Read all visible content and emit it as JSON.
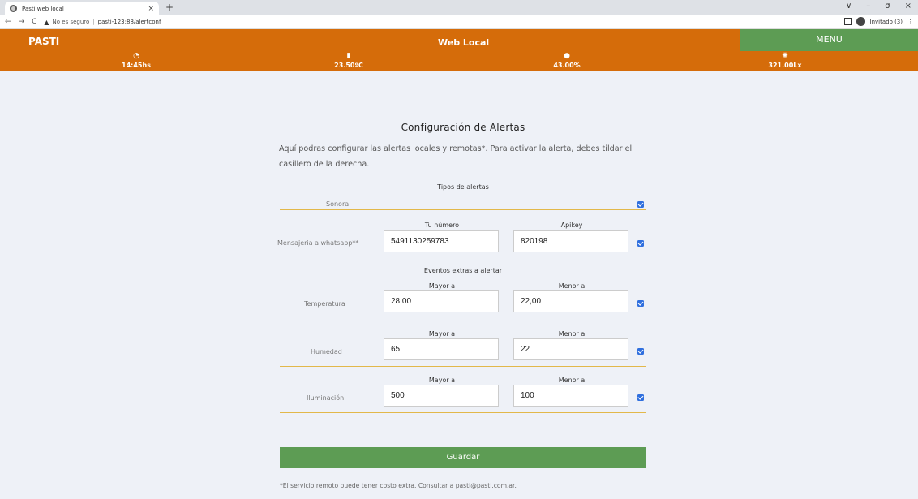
{
  "browser": {
    "tab_title": "Pasti web local",
    "tab_close": "×",
    "new_tab": "+",
    "win_controls": [
      "∨",
      "–",
      "σ",
      "×"
    ],
    "security": "No es seguro",
    "url": "pasti-123:88/alertconf",
    "profile": "Invitado (3)"
  },
  "header": {
    "brand": "PASTI",
    "center": "Web Local",
    "menu": "MENU"
  },
  "stats": [
    {
      "icon": "clock-icon",
      "glyph": "🕒",
      "value": "14:45hs"
    },
    {
      "icon": "thermometer-icon",
      "glyph": "🌡",
      "value": "23.50ºC"
    },
    {
      "icon": "drop-icon",
      "glyph": "💧",
      "value": "43.00%"
    },
    {
      "icon": "sun-icon",
      "glyph": "✺",
      "value": "321.00Lx"
    }
  ],
  "page": {
    "title": "Configuración de Alertas",
    "description": "Aquí podras configurar las alertas locales y remotas*. Para activar la alerta, debes tildar el casillero de la derecha.",
    "types_header": "Tipos de alertas",
    "sonora_label": "Sonora",
    "whatsapp": {
      "label": "Mensajeria a whatsapp**",
      "col1": "Tu número",
      "col2": "Apikey",
      "number": "5491130259783",
      "apikey": "820198"
    },
    "extras_header": "Eventos extras a alertar",
    "events": [
      {
        "label": "Temperatura",
        "col1": "Mayor a",
        "col2": "Menor a",
        "mayor": "28,00",
        "menor": "22,00"
      },
      {
        "label": "Humedad",
        "col1": "Mayor a",
        "col2": "Menor a",
        "mayor": "65",
        "menor": "22"
      },
      {
        "label": "Iluminación",
        "col1": "Mayor a",
        "col2": "Menor a",
        "mayor": "500",
        "menor": "100"
      }
    ],
    "save": "Guardar",
    "footnote": "*El servicio remoto puede tener costo extra. Consultar a pasti@pasti.com.ar."
  }
}
